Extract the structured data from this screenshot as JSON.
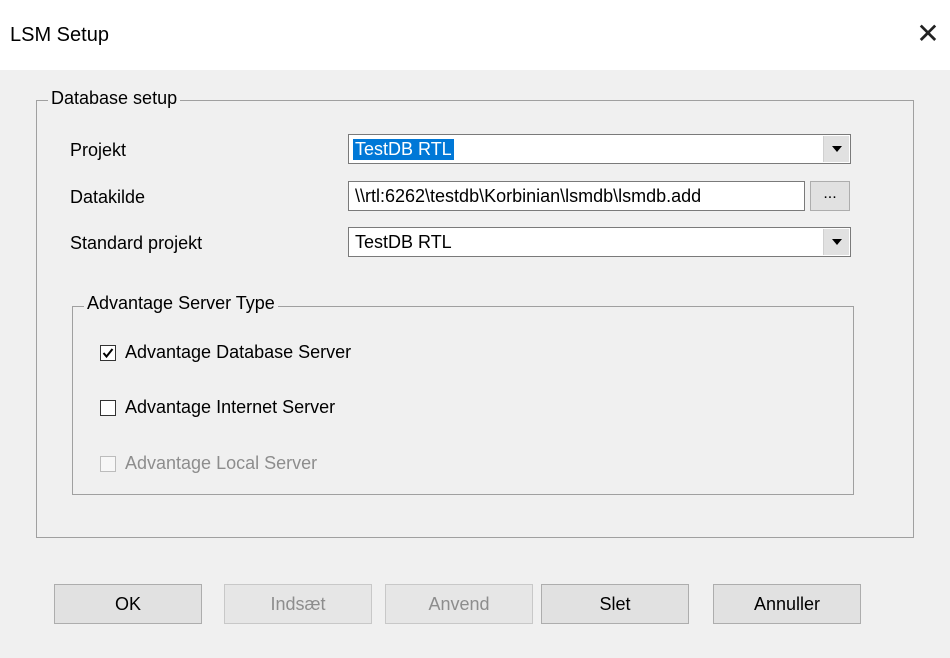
{
  "window": {
    "title": "LSM Setup",
    "close_glyph": "✕"
  },
  "database_setup": {
    "legend": "Database setup",
    "projekt_label": "Projekt",
    "projekt_value": "TestDB RTL",
    "datakilde_label": "Datakilde",
    "datakilde_value": "\\\\rtl:6262\\testdb\\Korbinian\\lsmdb\\lsmdb.add",
    "browse_label": "...",
    "standard_label": "Standard projekt",
    "standard_value": "TestDB RTL"
  },
  "server_type": {
    "legend": "Advantage Server Type",
    "options": [
      {
        "label": "Advantage Database Server",
        "checked": true,
        "enabled": true
      },
      {
        "label": "Advantage Internet Server",
        "checked": false,
        "enabled": true
      },
      {
        "label": "Advantage Local Server",
        "checked": false,
        "enabled": false
      }
    ]
  },
  "buttons": {
    "ok": "OK",
    "indsaet": "Indsæt",
    "anvend": "Anvend",
    "slet": "Slet",
    "annuller": "Annuller"
  },
  "icons": {
    "close": "close-icon",
    "dropdown": "chevron-down-icon",
    "check": "checkmark-icon"
  }
}
